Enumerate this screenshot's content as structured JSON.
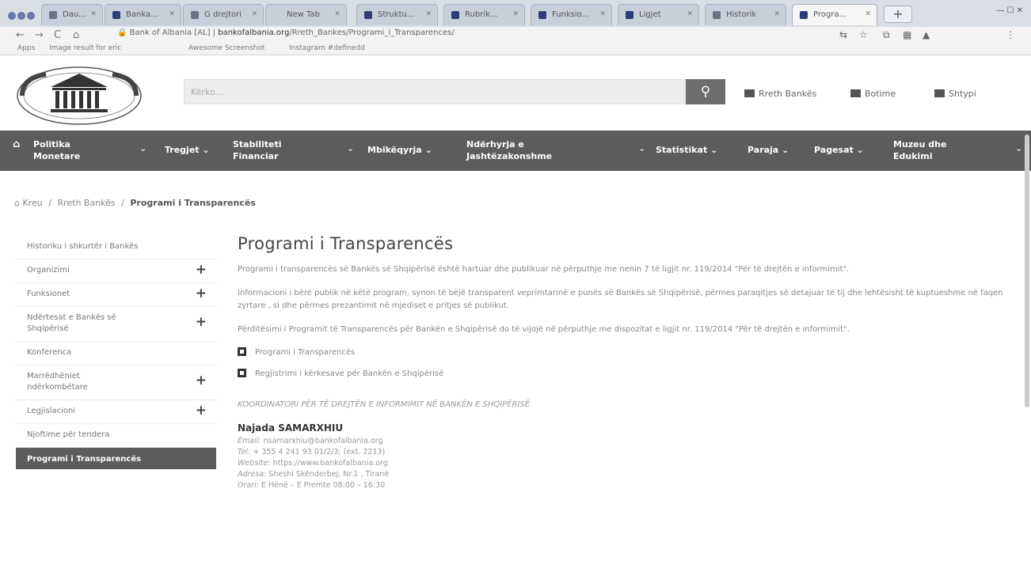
{
  "browser": {
    "tabs": [
      {
        "label": "Dau..."
      },
      {
        "label": "Banka..."
      },
      {
        "label": "G drejtori"
      },
      {
        "label": "New Tab"
      },
      {
        "label": "Struktu..."
      },
      {
        "label": "Rubrik..."
      },
      {
        "label": "Funksio..."
      },
      {
        "label": "Ligjet"
      },
      {
        "label": "Historik"
      },
      {
        "label": "Progra..."
      }
    ],
    "url_host_prefix": "Bank of Albania [AL] |",
    "url_domain": "bankofalbania.org",
    "url_path": "/Rreth_Bankes/Programi_i_Transparences/",
    "bookmarks": [
      "Apps",
      "Image result for eric",
      "Awesome Screenshot",
      "Instagram  #definedd"
    ],
    "window_controls": "—  ☐  ✕"
  },
  "header": {
    "search_placeholder": "Kërko...",
    "links": [
      "Rreth Bankës",
      "Botime",
      "Shtypi"
    ],
    "logo_alt_text": "BANKA E SHQIPËRISË · BANK OF ALBANIA"
  },
  "nav": [
    {
      "line1": "Politika",
      "line2": "Monetare"
    },
    {
      "line1": "Tregjet",
      "line2": ""
    },
    {
      "line1": "Stabiliteti",
      "line2": "Financiar"
    },
    {
      "line1": "Mbikëqyrja",
      "line2": ""
    },
    {
      "line1": "Ndërhyrja e",
      "line2": "Jashtëzakonshme"
    },
    {
      "line1": "Statistikat",
      "line2": ""
    },
    {
      "line1": "Paraja",
      "line2": ""
    },
    {
      "line1": "Pagesat",
      "line2": ""
    },
    {
      "line1": "Muzeu dhe",
      "line2": "Edukimi"
    }
  ],
  "breadcrumb": {
    "home": "Kreu",
    "sep": "/",
    "parent": "Rreth Bankës",
    "current": "Programi i Transparencës"
  },
  "sidebar": [
    {
      "label": "Historiku i shkurtër i Bankës",
      "expandable": false
    },
    {
      "label": "Organizimi",
      "expandable": true
    },
    {
      "label": "Funksionet",
      "expandable": true
    },
    {
      "label": "Ndërtesat e Bankës së Shqipërisë",
      "expandable": true
    },
    {
      "label": "Konferenca",
      "expandable": false
    },
    {
      "label": "Marrëdhëniet ndërkombëtare",
      "expandable": true
    },
    {
      "label": "Legjislacioni",
      "expandable": true
    },
    {
      "label": "Njoftime për tendera",
      "expandable": false
    },
    {
      "label": "Programi i Transparencës",
      "expandable": false,
      "active": true
    }
  ],
  "content": {
    "title": "Programi i Transparencës",
    "paragraphs": [
      "Programi i transparencës së Bankës së Shqipërisë është hartuar dhe publikuar në përputhje me nenin 7 të ligjit nr. 119/2014 \"Për të drejtën e informimit\".",
      "Informacioni i bërë publik në këtë program, synon të bëjë transparent veprimtarinë e punës së Bankës së Shqipërisë, përmes paraqitjes së detajuar të tij dhe lehtësisht të kuptueshme në faqen zyrtare , si dhe përmes prezantimit në mjediset e pritjes së publikut.",
      "Përditësimi i Programit të Transparencës për Bankën e Shqipërisë do të vijojë në përputhje me dispozitat e ligjit nr. 119/2014 \"Për të drejtën e informimit\"."
    ],
    "documents": [
      "Programi i Transparencës",
      "Regjistrimi i kërkesave për Bankën e Shqipërisë"
    ],
    "coordinator_heading": "KOORDINATORI PËR TË DREJTËN E INFORMIMIT NË BANKËN E SHQIPËRISË",
    "contact": {
      "name": "Najada SAMARXHIU",
      "email_label": "Email:",
      "email": "nsamarxhiu@bankofalbania.org",
      "tel_label": "Tel:",
      "tel": "+ 355 4 241 93 01/2/3; (ext. 2213)",
      "website_label": "Website:",
      "website": "https://www.bankofalbania.org",
      "address_label": "Adresa:",
      "address": "Sheshi Skënderbej, Nr.1 , Tiranë",
      "hours_label": "Orari:",
      "hours": "E Hënë – E Premte 08:00 – 16:30"
    }
  }
}
